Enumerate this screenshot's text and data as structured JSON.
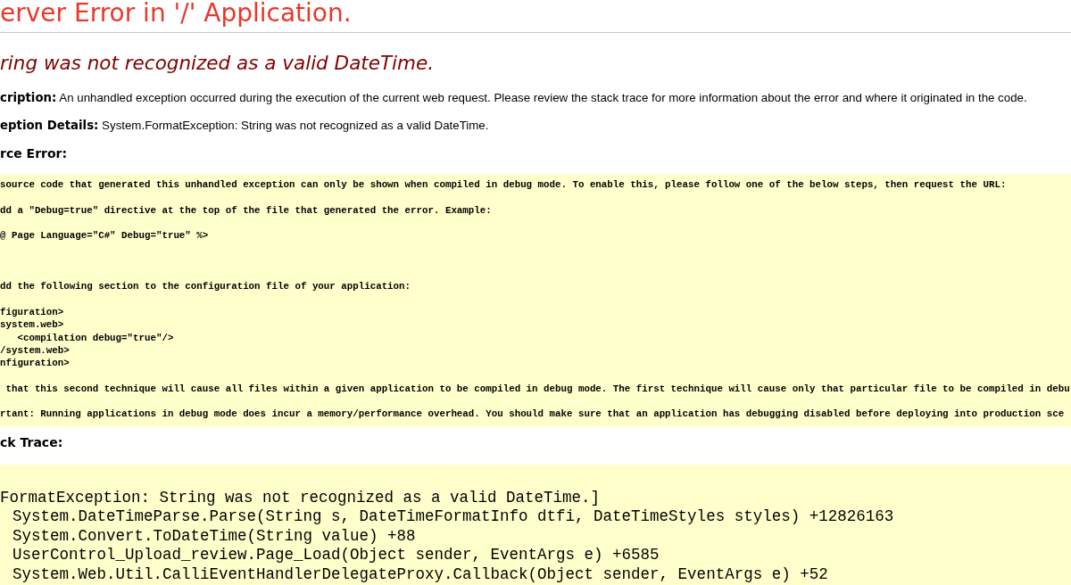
{
  "title": "erver Error in '/' Application.",
  "error_heading": "ring was not recognized as a valid DateTime.",
  "details": [
    {
      "text": "**cription:** An unhandled exception occurred during the execution of the current web request. Please review the stack trace for more information about the error and where it originated in the code."
    },
    {
      "text": "**eption Details:** System.FormatException: String was not recognized as a valid DateTime."
    }
  ],
  "source_error": {
    "heading": "rce Error:",
    "code": "source code that generated this unhandled exception can only be shown when compiled in debug mode. To enable this, please follow one of the below steps, then request the URL:\n\ndd a \"Debug=true\" directive at the top of the file that generated the error. Example:\n\n@ Page Language=\"C#\" Debug=\"true\" %>\n\n\n\ndd the following section to the configuration file of your application:\n\nfiguration>\nsystem.web>\n   <compilation debug=\"true\"/>\n/system.web>\nnfiguration>\n\n that this second technique will cause all files within a given application to be compiled in debug mode. The first technique will cause only that particular file to be compiled in debu\n\nrtant: Running applications in debug mode does incur a memory/performance overhead. You should make sure that an application has debugging disabled before deploying into production sce"
  },
  "stack_trace": {
    "heading": "ck Trace:",
    "header": "FormatException: String was not recognized as a valid DateTime.]",
    "frames": [
      "System.DateTimeParse.Parse(String s, DateTimeFormatInfo dtfi, DateTimeStyles styles) +12826163",
      "System.Convert.ToDateTime(String value) +88",
      "UserControl_Upload_review.Page_Load(Object sender, EventArgs e) +6585",
      "System.Web.Util.CalliEventHandlerDelegateProxy.Callback(Object sender, EventArgs e) +52"
    ]
  }
}
